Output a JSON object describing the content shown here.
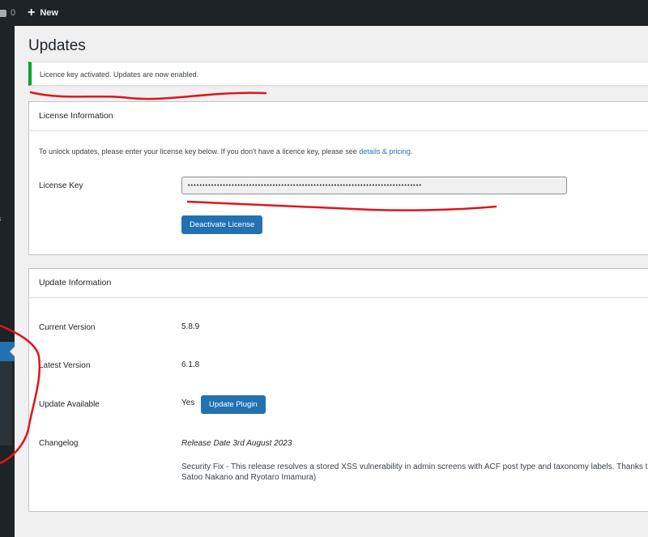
{
  "admin_bar": {
    "comments_count": "0",
    "new_label": "New"
  },
  "page": {
    "title": "Updates",
    "notice": "Licence key activated. Updates are now enabled."
  },
  "license_box": {
    "title": "License Information",
    "intro_text": "To unlock updates, please enter your license key below. If you don't have a licence key, please see ",
    "intro_link": "details & pricing",
    "intro_end": ".",
    "key_label": "License Key",
    "key_value": "••••••••••••••••••••••••••••••••••••••••••••••••••••••••••••••••••••••••••••••••",
    "deactivate_label": "Deactivate License"
  },
  "update_box": {
    "title": "Update Information",
    "current_version_label": "Current Version",
    "current_version": "5.8.9",
    "latest_version_label": "Latest Version",
    "latest_version": "6.1.8",
    "update_available_label": "Update Available",
    "update_available": "Yes",
    "update_button_label": "Update Plugin",
    "changelog_label": "Changelog",
    "release_date": "Release Date 3rd August 2023",
    "changelog_text": "Security Fix - This release resolves a stored XSS vulnerability in admin screens with ACF post type and taxonomy labels. Thanks to Satoo Nakano and Ryotaro Imamura)"
  },
  "colors": {
    "admin_bar": "#1d2327",
    "accent": "#2271b1",
    "success_border": "#00a32a",
    "annotation_red": "#e0141b"
  },
  "icons": [
    "comment-bubble-icon",
    "plus-icon"
  ]
}
